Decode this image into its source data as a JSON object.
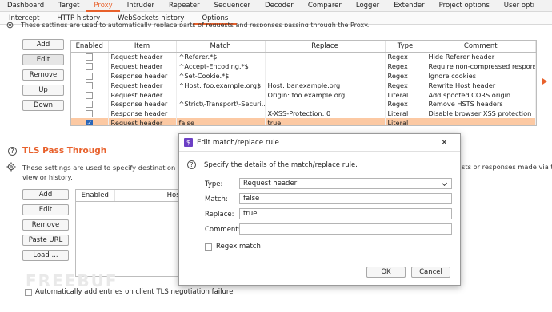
{
  "top_tabs": [
    "Dashboard",
    "Target",
    "Proxy",
    "Intruder",
    "Repeater",
    "Sequencer",
    "Decoder",
    "Comparer",
    "Logger",
    "Extender",
    "Project options",
    "User opti"
  ],
  "sub_tabs": [
    "Intercept",
    "HTTP history",
    "WebSockets history",
    "Options"
  ],
  "replace_section": {
    "description_cut": "These settings are used to automatically replace parts of requests and responses passing through the Proxy.",
    "buttons": [
      "Add",
      "Edit",
      "Remove",
      "Up",
      "Down"
    ],
    "columns": [
      "Enabled",
      "Item",
      "Match",
      "Replace",
      "Type",
      "Comment"
    ],
    "rows": [
      {
        "enabled": false,
        "item": "Request header",
        "match": "^Referer.*$",
        "replace": "",
        "type": "Regex",
        "comment": "Hide Referer header"
      },
      {
        "enabled": false,
        "item": "Request header",
        "match": "^Accept-Encoding.*$",
        "replace": "",
        "type": "Regex",
        "comment": "Require non-compressed responses"
      },
      {
        "enabled": false,
        "item": "Response header",
        "match": "^Set-Cookie.*$",
        "replace": "",
        "type": "Regex",
        "comment": "Ignore cookies"
      },
      {
        "enabled": false,
        "item": "Request header",
        "match": "^Host: foo.example.org$",
        "replace": "Host: bar.example.org",
        "type": "Regex",
        "comment": "Rewrite Host header"
      },
      {
        "enabled": false,
        "item": "Request header",
        "match": "",
        "replace": "Origin: foo.example.org",
        "type": "Literal",
        "comment": "Add spoofed CORS origin"
      },
      {
        "enabled": false,
        "item": "Response header",
        "match": "^Strict\\-Transport\\-Securi...",
        "replace": "",
        "type": "Regex",
        "comment": "Remove HSTS headers"
      },
      {
        "enabled": false,
        "item": "Response header",
        "match": "",
        "replace": "X-XSS-Protection: 0",
        "type": "Literal",
        "comment": "Disable browser XSS protection"
      },
      {
        "enabled": true,
        "item": "Request header",
        "match": "false",
        "replace": "true",
        "type": "Literal",
        "comment": ""
      }
    ]
  },
  "tls_section": {
    "title": "TLS Pass Through",
    "description_left": "These settings are used to specify destination web",
    "description_left2": "view or history.",
    "description_right": "sts or responses made via thes",
    "buttons": [
      "Add",
      "Edit",
      "Remove",
      "Paste URL",
      "Load ..."
    ],
    "columns": [
      "Enabled",
      "Host"
    ],
    "auto_add_label": "Automatically add entries on client TLS negotiation failure"
  },
  "watermark": "FREEBUF",
  "dialog": {
    "title": "Edit match/replace rule",
    "logo": "$",
    "close": "✕",
    "prompt": "Specify the details of the match/replace rule.",
    "type_label": "Type:",
    "type_value": "Request header",
    "match_label": "Match:",
    "match_value": "false",
    "replace_label": "Replace:",
    "replace_value": "true",
    "comment_label": "Comment:",
    "comment_value": "",
    "regex_label": "Regex match",
    "ok": "OK",
    "cancel": "Cancel"
  },
  "colors": {
    "accent": "#e8612c",
    "highlight_row": "#fcc9a3",
    "checkbox_on": "#2a66b8",
    "dialog_logo": "#6c3fc5"
  }
}
